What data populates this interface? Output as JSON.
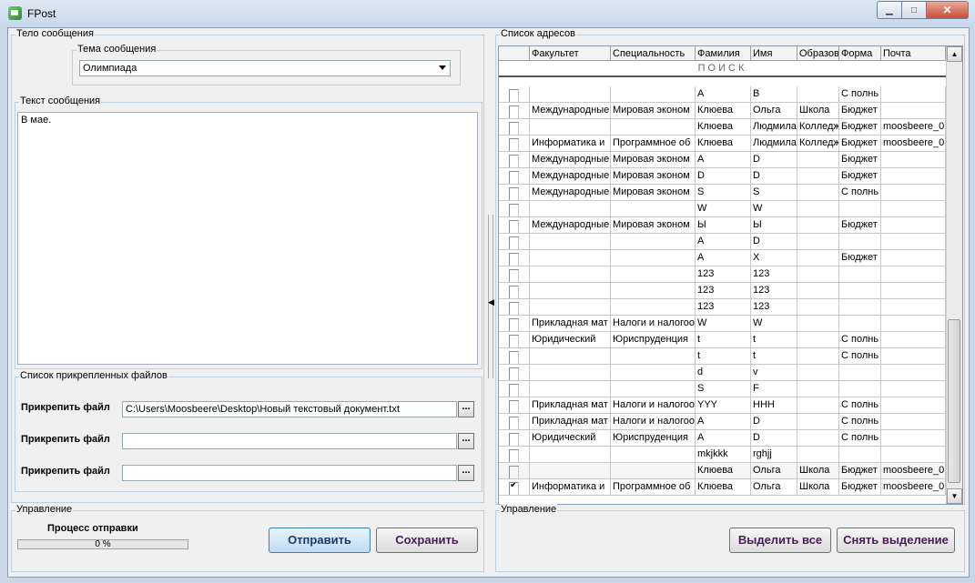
{
  "window": {
    "title": "FPost"
  },
  "left": {
    "body_group": "Тело сообщения",
    "subject_group": "Тема сообщения",
    "subject_value": "Олимпиада",
    "text_group": "Текст сообщения",
    "text_value": "В мае.",
    "files_group": "Список прикрепленных файлов",
    "attach_label": "Прикрепить файл",
    "files": [
      "C:\\Users\\Moosbeere\\Desktop\\Новый текстовый документ.txt",
      "",
      ""
    ],
    "browse_label": "...",
    "control_group": "Управление",
    "progress_label": "Процесс отправки",
    "progress_text": "0 %",
    "progress_value": 0,
    "send_button": "Отправить",
    "save_button": "Сохранить"
  },
  "right": {
    "list_group": "Список адресов",
    "columns": [
      "",
      "Факультет",
      "Специальность",
      "Фамилия",
      "Имя",
      "Образов",
      "Форма",
      "Почта"
    ],
    "search_label": "ПОИСК",
    "rows": [
      {
        "checked": false,
        "cells": [
          "",
          "",
          "А",
          "В",
          "",
          "С полнь",
          ""
        ]
      },
      {
        "checked": false,
        "cells": [
          "Международные",
          "Мировая эконом",
          "Клюева",
          "Ольга",
          "Школа",
          "Бюджет",
          ""
        ]
      },
      {
        "checked": false,
        "cells": [
          "",
          "",
          "Клюева",
          "Людмила",
          "Колледж",
          "Бюджет",
          "moosbeere_0("
        ]
      },
      {
        "checked": false,
        "cells": [
          "Информатика и",
          "Программное об",
          "Клюева",
          "Людмила",
          "Колледж",
          "Бюджет",
          "moosbeere_0("
        ]
      },
      {
        "checked": false,
        "cells": [
          "Международные",
          "Мировая эконом",
          "А",
          "D",
          "",
          "Бюджет",
          ""
        ]
      },
      {
        "checked": false,
        "cells": [
          "Международные",
          "Мировая эконом",
          "D",
          "D",
          "",
          "Бюджет",
          ""
        ]
      },
      {
        "checked": false,
        "cells": [
          "Международные",
          "Мировая эконом",
          "S",
          "S",
          "",
          "С полнь",
          ""
        ]
      },
      {
        "checked": false,
        "cells": [
          "",
          "",
          "W",
          "W",
          "",
          "",
          ""
        ]
      },
      {
        "checked": false,
        "cells": [
          "Международные",
          "Мировая эконом",
          "Ы",
          "Ы",
          "",
          "Бюджет",
          ""
        ]
      },
      {
        "checked": false,
        "cells": [
          "",
          "",
          "А",
          "D",
          "",
          "",
          ""
        ]
      },
      {
        "checked": false,
        "cells": [
          "",
          "",
          "А",
          "Х",
          "",
          "Бюджет",
          ""
        ]
      },
      {
        "checked": false,
        "cells": [
          "",
          "",
          "123",
          "123",
          "",
          "",
          ""
        ]
      },
      {
        "checked": false,
        "cells": [
          "",
          "",
          "123",
          "123",
          "",
          "",
          ""
        ]
      },
      {
        "checked": false,
        "cells": [
          "",
          "",
          "123",
          "123",
          "",
          "",
          ""
        ]
      },
      {
        "checked": false,
        "cells": [
          "Прикладная мат",
          "Налоги и налогоо",
          "W",
          "W",
          "",
          "",
          ""
        ]
      },
      {
        "checked": false,
        "cells": [
          "Юридический",
          "Юриспруденция",
          "t",
          "t",
          "",
          "С полнь",
          ""
        ]
      },
      {
        "checked": false,
        "cells": [
          "",
          "",
          "t",
          "t",
          "",
          "С полнь",
          ""
        ]
      },
      {
        "checked": false,
        "cells": [
          "",
          "",
          "d",
          "v",
          "",
          "",
          ""
        ]
      },
      {
        "checked": false,
        "cells": [
          "",
          "",
          "S",
          "F",
          "",
          "",
          ""
        ]
      },
      {
        "checked": false,
        "cells": [
          "Прикладная мат",
          "Налоги и налогоо",
          "YYY",
          "HHH",
          "",
          "С полнь",
          ""
        ]
      },
      {
        "checked": false,
        "cells": [
          "Прикладная мат",
          "Налоги и налогоо",
          "А",
          "D",
          "",
          "С полнь",
          ""
        ]
      },
      {
        "checked": false,
        "cells": [
          "Юридический",
          "Юриспруденция",
          "А",
          "D",
          "",
          "С полнь",
          ""
        ]
      },
      {
        "checked": false,
        "cells": [
          "",
          "",
          "mkjkkk",
          "rghjj",
          "",
          "",
          ""
        ]
      },
      {
        "checked": false,
        "cells": [
          "",
          "",
          "Клюева",
          "Ольга",
          "Школа",
          "Бюджет",
          "moosbeere_0("
        ]
      },
      {
        "checked": true,
        "cells": [
          "Информатика и",
          "Программное об",
          "Клюева",
          "Ольга",
          "Школа",
          "Бюджет",
          "moosbeere_0("
        ]
      }
    ],
    "control_group": "Управление",
    "select_all_button": "Выделить все",
    "deselect_button": "Снять выделение"
  }
}
